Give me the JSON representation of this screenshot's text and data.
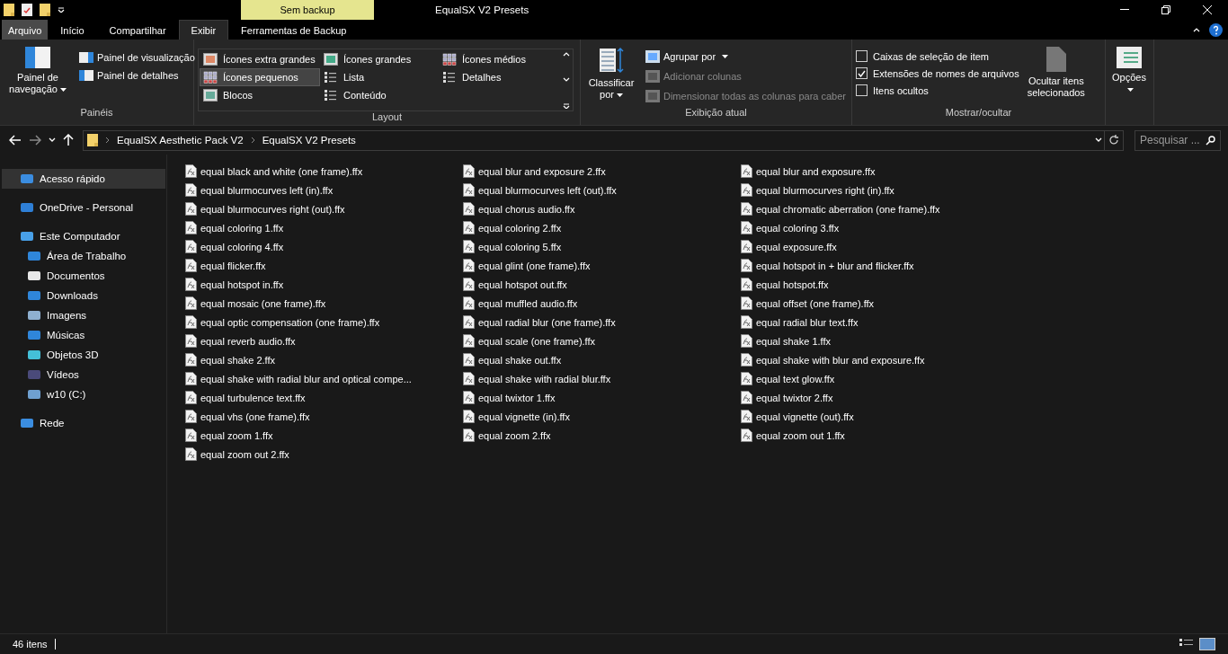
{
  "window": {
    "title": "EqualSX V2 Presets",
    "context_header": "Sem backup"
  },
  "tabs": [
    {
      "label": "Arquivo",
      "kind": "file",
      "selected": false
    },
    {
      "label": "Início",
      "kind": "tab",
      "selected": false
    },
    {
      "label": "Compartilhar",
      "kind": "tab",
      "selected": false
    },
    {
      "label": "Exibir",
      "kind": "tab",
      "selected": true
    },
    {
      "label": "Ferramentas de Backup",
      "kind": "tab",
      "selected": false
    }
  ],
  "ribbon": {
    "panes": {
      "label": "Painéis",
      "nav_pane": "Painel de navegação",
      "items": [
        "Painel de visualização",
        "Painel de detalhes"
      ]
    },
    "layout": {
      "label": "Layout",
      "items": [
        {
          "label": "Ícones extra grandes",
          "selected": false
        },
        {
          "label": "Ícones grandes",
          "selected": false
        },
        {
          "label": "Ícones médios",
          "selected": false
        },
        {
          "label": "Ícones pequenos",
          "selected": true
        },
        {
          "label": "Lista",
          "selected": false
        },
        {
          "label": "Detalhes",
          "selected": false
        },
        {
          "label": "Blocos",
          "selected": false
        },
        {
          "label": "Conteúdo",
          "selected": false
        }
      ]
    },
    "current_view": {
      "label": "Exibição atual",
      "sort": "Classificar por",
      "items": [
        {
          "label": "Agrupar por",
          "disabled": false
        },
        {
          "label": "Adicionar colunas",
          "disabled": true
        },
        {
          "label": "Dimensionar todas as colunas para caber",
          "disabled": true
        }
      ]
    },
    "show_hide": {
      "label": "Mostrar/ocultar",
      "checks": [
        {
          "label": "Caixas de seleção de item",
          "checked": false
        },
        {
          "label": "Extensões de nomes de arquivos",
          "checked": true
        },
        {
          "label": "Itens ocultos",
          "checked": false
        }
      ],
      "hide_selected": "Ocultar itens selecionados",
      "options": "Opções"
    }
  },
  "breadcrumb": [
    "EqualSX Aesthetic Pack V2",
    "EqualSX V2 Presets"
  ],
  "search": {
    "placeholder": "Pesquisar ..."
  },
  "sidebar": {
    "items": [
      {
        "label": "Acesso rápido",
        "selected": true
      },
      {
        "label": "OneDrive - Personal",
        "selected": false
      },
      {
        "label": "Este Computador",
        "selected": false,
        "children": [
          {
            "label": "Área de Trabalho",
            "selected": false
          },
          {
            "label": "Documentos",
            "selected": false
          },
          {
            "label": "Downloads",
            "selected": false
          },
          {
            "label": "Imagens",
            "selected": false
          },
          {
            "label": "Músicas",
            "selected": false
          },
          {
            "label": "Objetos 3D",
            "selected": false
          },
          {
            "label": "Vídeos",
            "selected": false
          },
          {
            "label": "w10 (C:)",
            "selected": false
          }
        ]
      },
      {
        "label": "Rede",
        "selected": false
      }
    ]
  },
  "files": [
    "equal black and white (one frame).ffx",
    "equal blur and exposure 2.ffx",
    "equal blur and exposure.ffx",
    "equal blurmocurves left (in).ffx",
    "equal blurmocurves left (out).ffx",
    "equal blurmocurves right (in).ffx",
    "equal blurmocurves right (out).ffx",
    "equal chorus audio.ffx",
    "equal chromatic aberration (one frame).ffx",
    "equal coloring 1.ffx",
    "equal coloring 2.ffx",
    "equal coloring 3.ffx",
    "equal coloring 4.ffx",
    "equal coloring 5.ffx",
    "equal exposure.ffx",
    "equal flicker.ffx",
    "equal glint (one frame).ffx",
    "equal hotspot in + blur and flicker.ffx",
    "equal hotspot in.ffx",
    "equal hotspot out.ffx",
    "equal hotspot.ffx",
    "equal mosaic (one frame).ffx",
    "equal muffled audio.ffx",
    "equal offset (one frame).ffx",
    "equal optic compensation (one frame).ffx",
    "equal radial blur (one frame).ffx",
    "equal radial blur text.ffx",
    "equal reverb audio.ffx",
    "equal scale (one frame).ffx",
    "equal shake 1.ffx",
    "equal shake 2.ffx",
    "equal shake out.ffx",
    "equal shake with blur and exposure.ffx",
    "equal shake with radial blur and optical compe...",
    "equal shake with radial blur.ffx",
    "equal text glow.ffx",
    "equal turbulence text.ffx",
    "equal twixtor 1.ffx",
    "equal twixtor 2.ffx",
    "equal vhs (one frame).ffx",
    "equal vignette (in).ffx",
    "equal vignette (out).ffx",
    "equal zoom 1.ffx",
    "equal zoom 2.ffx",
    "equal zoom out 1.ffx",
    "equal zoom out 2.ffx"
  ],
  "status_bar": {
    "count": "46 itens"
  }
}
